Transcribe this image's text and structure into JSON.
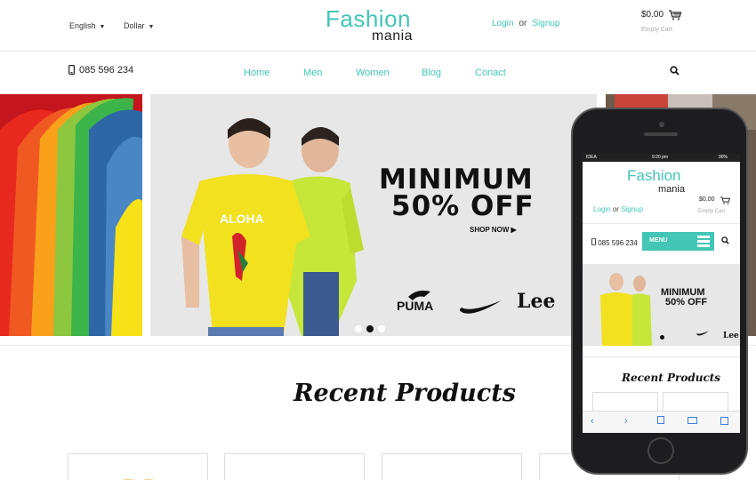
{
  "header": {
    "language": "English",
    "currency": "Dollar",
    "logo_top": "Fashion",
    "logo_bottom": "mania",
    "login": "Login",
    "or": "or",
    "signup": "Signup",
    "cart_amount": "$0.00",
    "cart_status": "Empty Cart"
  },
  "nav": {
    "phone": "085 596 234",
    "items": [
      "Home",
      "Men",
      "Women",
      "Blog",
      "Conact"
    ]
  },
  "hero": {
    "line1": "MINIMUM",
    "line2": "50% OFF",
    "cta": "SHOP NOW",
    "shirt_text": "ALOHA",
    "brands": [
      "PUMA",
      "Lee"
    ]
  },
  "section": {
    "title": "Recent Products"
  },
  "mobile": {
    "carrier": "IDEA",
    "time": "9:20 pm",
    "battery": "90%",
    "logo_top": "Fashion",
    "logo_bottom": "mania",
    "login": "Login",
    "or": "or",
    "signup": "Signup",
    "cart_amount": "$0.00",
    "cart_status": "Empty Cart",
    "phone": "085 596 234",
    "menu": "MENU",
    "promo1": "MINIMUM",
    "promo2": "50% OFF",
    "brand": "Lee",
    "recent_title": "Recent Products"
  },
  "colors": {
    "accent": "#43c6b5",
    "text": "#222222",
    "hero_bg": "#e7e7e7"
  }
}
